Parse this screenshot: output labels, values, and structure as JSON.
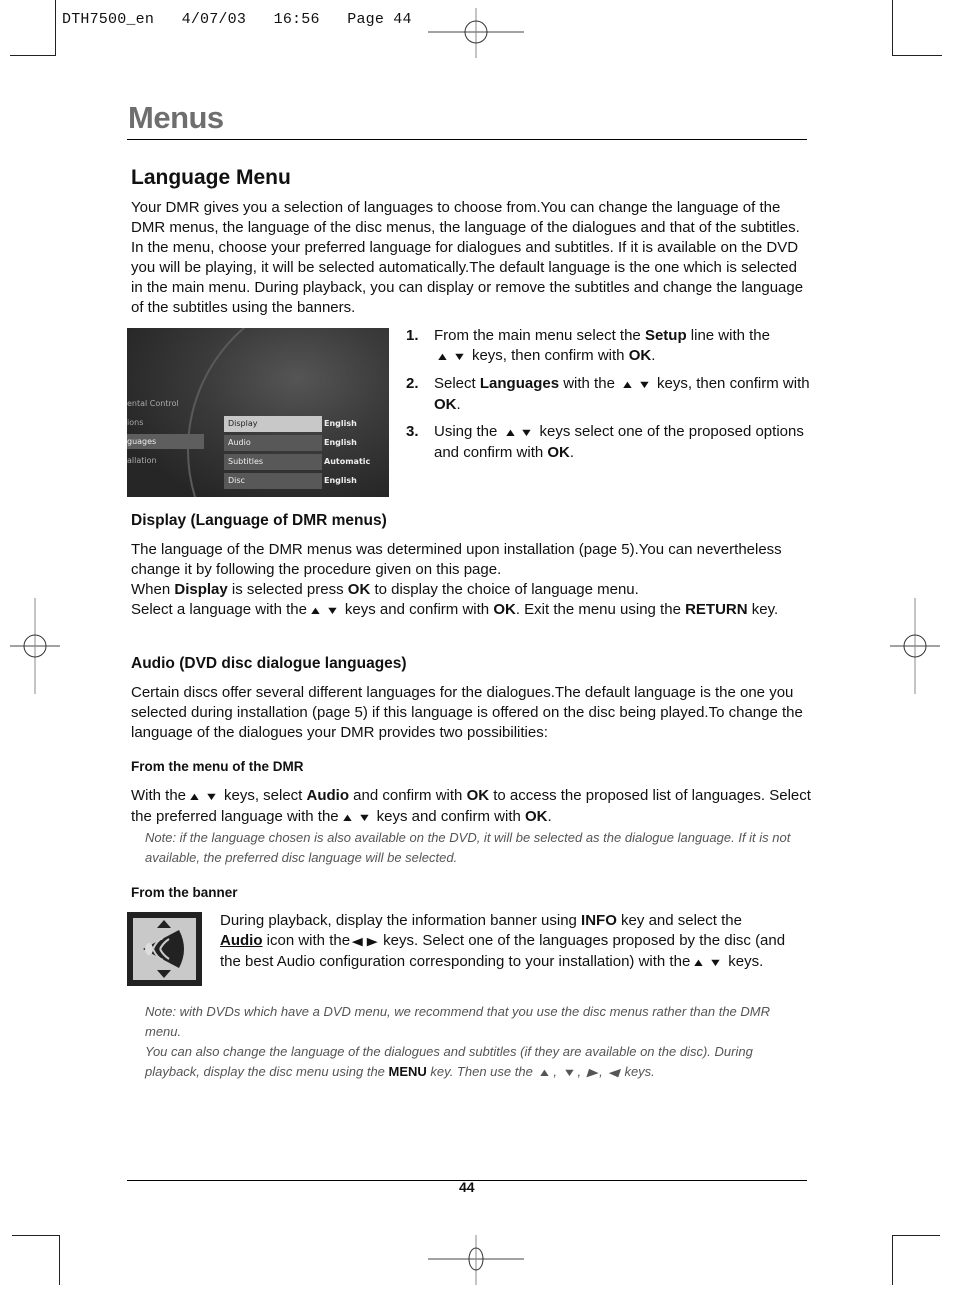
{
  "slug": "DTH7500_en   4/07/03   16:56   Page 44",
  "page_title": "Menus",
  "section": {
    "title": "Language Menu",
    "intro": "Your DMR gives you a selection of languages to choose from.You can change the language of the DMR menus, the language of the disc menus, the language of the dialogues and that of the subtitles. In the menu, choose your preferred language for dialogues and subtitles. If it is available on the DVD you will be playing, it will be selected automatically.The default language is the one which is selected in the main menu. During playback, you can display or remove the subtitles and change the language of the subtitles using the banners."
  },
  "screenshot": {
    "left_menu": [
      "ental Control",
      "ions",
      "guages",
      "allation"
    ],
    "options": [
      {
        "label": "Display",
        "value": "English"
      },
      {
        "label": "Audio",
        "value": "English"
      },
      {
        "label": "Subtitles",
        "value": "Automatic"
      },
      {
        "label": "Disc",
        "value": "English"
      }
    ]
  },
  "steps": [
    {
      "num": "1.",
      "parts": [
        "From the main menu select the ",
        "Setup",
        " line with the ",
        "keys, then confirm with ",
        "OK",
        "."
      ]
    },
    {
      "num": "2.",
      "parts": [
        "Select ",
        "Languages",
        " with the ",
        "keys, then confirm with ",
        "OK",
        "."
      ]
    },
    {
      "num": "3.",
      "parts": [
        "Using the ",
        "",
        "",
        "keys select one of the proposed options and confirm with ",
        "OK",
        "."
      ]
    }
  ],
  "display": {
    "heading": "Display (Language of DMR menus)",
    "p1": "The language of the DMR menus was determined upon installation (page 5).You can nevertheless change it by following the procedure given on this page.",
    "p2a": "When ",
    "p2b": "Display",
    "p2c": " is selected press ",
    "p2d": "OK",
    "p2e": " to display the choice of language menu.",
    "p3a": "Select a language with the",
    "p3b": "keys and confirm with ",
    "p3c": "OK",
    "p3d": ". Exit the menu using the ",
    "p3e": "RETURN",
    "p3f": " key."
  },
  "audio": {
    "heading": "Audio (DVD disc dialogue languages)",
    "intro": "Certain discs offer several different languages for the dialogues.The default language is the one you selected during installation (page 5) if this language is offered on the disc being played.To change the language of the dialogues your DMR provides two possibilities:",
    "dmr_heading": "From the menu of the DMR",
    "dmr_a": "With the",
    "dmr_b": "keys, select ",
    "dmr_c": "Audio",
    "dmr_d": " and confirm with ",
    "dmr_e": "OK",
    "dmr_f": " to access the proposed list of languages. Select the preferred language with the",
    "dmr_g": "keys and confirm with ",
    "dmr_h": "OK",
    "dmr_i": ".",
    "note1": "Note: if the language chosen is also available on the DVD, it will be selected as the dialogue language. If it is not available, the preferred disc language will be selected.",
    "banner_heading": "From the banner",
    "banner_a": "During playback, display the information banner using ",
    "banner_b": "INFO",
    "banner_c": " key and select the ",
    "banner_d": "Audio",
    "banner_e": " icon with the",
    "banner_f": "keys. Select one of the languages proposed by the disc (and the best Audio configuration corresponding to your installation) with the",
    "banner_g": "keys.",
    "note2a": "Note: with DVDs which have a DVD menu, we recommend that you use the disc menus rather than the DMR menu.",
    "note2b": "You can also change the language of the dialogues and subtitles (if they are available on the disc). During playback, display the disc menu using the ",
    "note2c": "MENU",
    "note2d": " key.  Then use the ",
    "note2e": " keys."
  },
  "folio": "44",
  "icons": {
    "up": "▲",
    "down": "▼",
    "left": "◀",
    "right": "▶"
  }
}
